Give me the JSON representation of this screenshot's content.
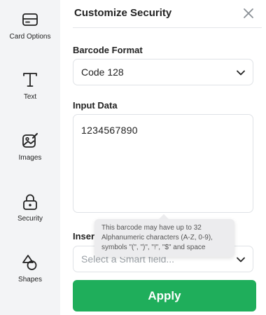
{
  "sidebar": {
    "items": [
      {
        "label": "Card Options",
        "icon": "card-icon"
      },
      {
        "label": "Text",
        "icon": "text-icon"
      },
      {
        "label": "Images",
        "icon": "image-icon"
      },
      {
        "label": "Security",
        "icon": "lock-icon"
      },
      {
        "label": "Shapes",
        "icon": "shapes-icon"
      }
    ]
  },
  "panel": {
    "title": "Customize Security",
    "close_icon": "close-icon",
    "barcode_format": {
      "label": "Barcode Format",
      "value": "Code 128"
    },
    "input_data": {
      "label": "Input Data",
      "value": "1234567890"
    },
    "smart_field": {
      "label": "Insert Smart Field",
      "placeholder": "Select a Smart field..."
    },
    "tooltip": "This barcode may have up to 32 Alphanumeric characters (A-Z, 0-9), symbols \"(\", \")\", \"!\", \"$\" and space",
    "apply_label": "Apply"
  },
  "colors": {
    "accent": "#1fae5b",
    "sidebar_bg": "#f3f4f6",
    "border": "#dfe2e6"
  }
}
